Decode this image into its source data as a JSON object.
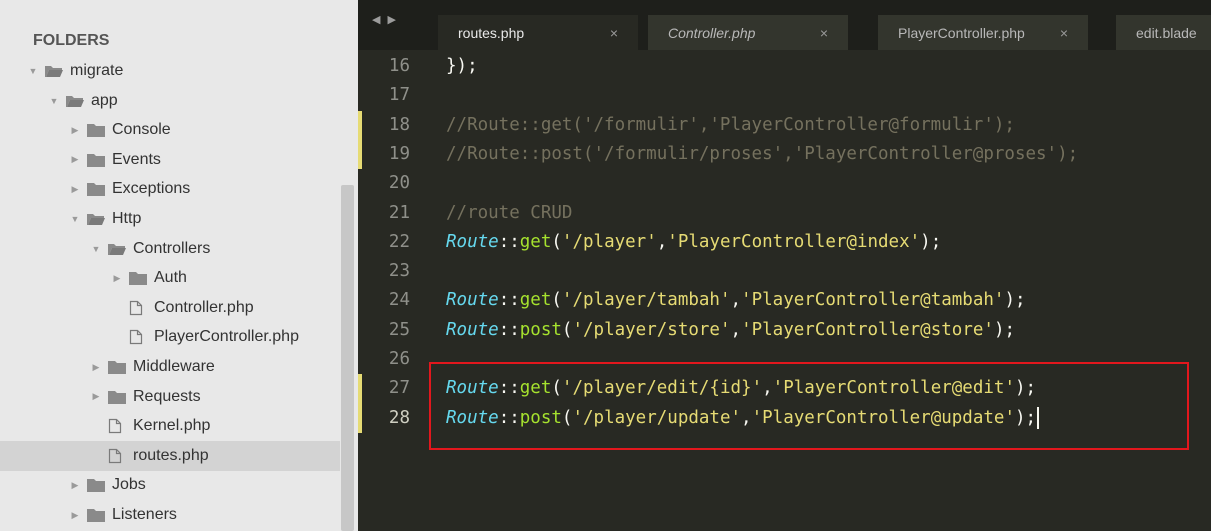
{
  "sidebar": {
    "header": "FOLDERS",
    "tree": [
      {
        "label": "migrate",
        "type": "folder",
        "open": true,
        "indent": 0
      },
      {
        "label": "app",
        "type": "folder",
        "open": true,
        "indent": 1
      },
      {
        "label": "Console",
        "type": "folder",
        "open": false,
        "indent": 2
      },
      {
        "label": "Events",
        "type": "folder",
        "open": false,
        "indent": 2
      },
      {
        "label": "Exceptions",
        "type": "folder",
        "open": false,
        "indent": 2
      },
      {
        "label": "Http",
        "type": "folder",
        "open": true,
        "indent": 2
      },
      {
        "label": "Controllers",
        "type": "folder",
        "open": true,
        "indent": 3
      },
      {
        "label": "Auth",
        "type": "folder",
        "open": false,
        "indent": 4
      },
      {
        "label": "Controller.php",
        "type": "file",
        "indent": 4
      },
      {
        "label": "PlayerController.php",
        "type": "file",
        "indent": 4
      },
      {
        "label": "Middleware",
        "type": "folder",
        "open": false,
        "indent": 3
      },
      {
        "label": "Requests",
        "type": "folder",
        "open": false,
        "indent": 3
      },
      {
        "label": "Kernel.php",
        "type": "file",
        "indent": 3
      },
      {
        "label": "routes.php",
        "type": "file",
        "indent": 3,
        "selected": true
      },
      {
        "label": "Jobs",
        "type": "folder",
        "open": false,
        "indent": 2
      },
      {
        "label": "Listeners",
        "type": "folder",
        "open": false,
        "indent": 2
      }
    ]
  },
  "tabs": [
    {
      "label": "routes.php",
      "active": true,
      "italic": false,
      "close": "×"
    },
    {
      "label": "Controller.php",
      "active": false,
      "italic": true,
      "close": "×"
    },
    {
      "label": "PlayerController.php",
      "active": false,
      "italic": false,
      "close": "×"
    },
    {
      "label": "edit.blade",
      "active": false,
      "italic": false,
      "close": ""
    }
  ],
  "nav_arrows": "◀ ▶",
  "code_lines": [
    {
      "num": "16",
      "parts": [
        {
          "t": "});",
          "c": "pun"
        }
      ]
    },
    {
      "num": "17",
      "parts": []
    },
    {
      "num": "18",
      "modified": true,
      "parts": [
        {
          "t": "//Route::get('/formulir','PlayerController@formulir');",
          "c": "comment"
        }
      ]
    },
    {
      "num": "19",
      "modified": true,
      "parts": [
        {
          "t": "//Route::post('/formulir/proses','PlayerController@proses');",
          "c": "comment"
        }
      ]
    },
    {
      "num": "20",
      "parts": []
    },
    {
      "num": "21",
      "parts": [
        {
          "t": "//route CRUD",
          "c": "comment"
        }
      ]
    },
    {
      "num": "22",
      "parts": [
        {
          "t": "Route",
          "c": "cls"
        },
        {
          "t": "::",
          "c": "pun"
        },
        {
          "t": "get",
          "c": "fn"
        },
        {
          "t": "(",
          "c": "pun"
        },
        {
          "t": "'/player'",
          "c": "str"
        },
        {
          "t": ",",
          "c": "pun"
        },
        {
          "t": "'PlayerController@index'",
          "c": "str"
        },
        {
          "t": ");",
          "c": "pun"
        }
      ]
    },
    {
      "num": "23",
      "parts": []
    },
    {
      "num": "24",
      "parts": [
        {
          "t": "Route",
          "c": "cls"
        },
        {
          "t": "::",
          "c": "pun"
        },
        {
          "t": "get",
          "c": "fn"
        },
        {
          "t": "(",
          "c": "pun"
        },
        {
          "t": "'/player/tambah'",
          "c": "str"
        },
        {
          "t": ",",
          "c": "pun"
        },
        {
          "t": "'PlayerController@tambah'",
          "c": "str"
        },
        {
          "t": ");",
          "c": "pun"
        }
      ]
    },
    {
      "num": "25",
      "parts": [
        {
          "t": "Route",
          "c": "cls"
        },
        {
          "t": "::",
          "c": "pun"
        },
        {
          "t": "post",
          "c": "fn"
        },
        {
          "t": "(",
          "c": "pun"
        },
        {
          "t": "'/player/store'",
          "c": "str"
        },
        {
          "t": ",",
          "c": "pun"
        },
        {
          "t": "'PlayerController@store'",
          "c": "str"
        },
        {
          "t": ");",
          "c": "pun"
        }
      ]
    },
    {
      "num": "26",
      "parts": []
    },
    {
      "num": "27",
      "modified": true,
      "parts": [
        {
          "t": "Route",
          "c": "cls"
        },
        {
          "t": "::",
          "c": "pun"
        },
        {
          "t": "get",
          "c": "fn"
        },
        {
          "t": "(",
          "c": "pun"
        },
        {
          "t": "'/player/edit/{id}'",
          "c": "str"
        },
        {
          "t": ",",
          "c": "pun"
        },
        {
          "t": "'PlayerController@edit'",
          "c": "str"
        },
        {
          "t": ");",
          "c": "pun"
        }
      ]
    },
    {
      "num": "28",
      "modified": true,
      "current": true,
      "cursor": true,
      "parts": [
        {
          "t": "Route",
          "c": "cls"
        },
        {
          "t": "::",
          "c": "pun"
        },
        {
          "t": "post",
          "c": "fn"
        },
        {
          "t": "(",
          "c": "pun"
        },
        {
          "t": "'/player/update'",
          "c": "str"
        },
        {
          "t": ",",
          "c": "pun"
        },
        {
          "t": "'PlayerController@update'",
          "c": "str"
        },
        {
          "t": ");",
          "c": "pun"
        }
      ]
    }
  ],
  "colors": {
    "sidebar_bg": "#e8e8e8",
    "editor_bg": "#282923",
    "highlight_box": "#e2171d"
  }
}
